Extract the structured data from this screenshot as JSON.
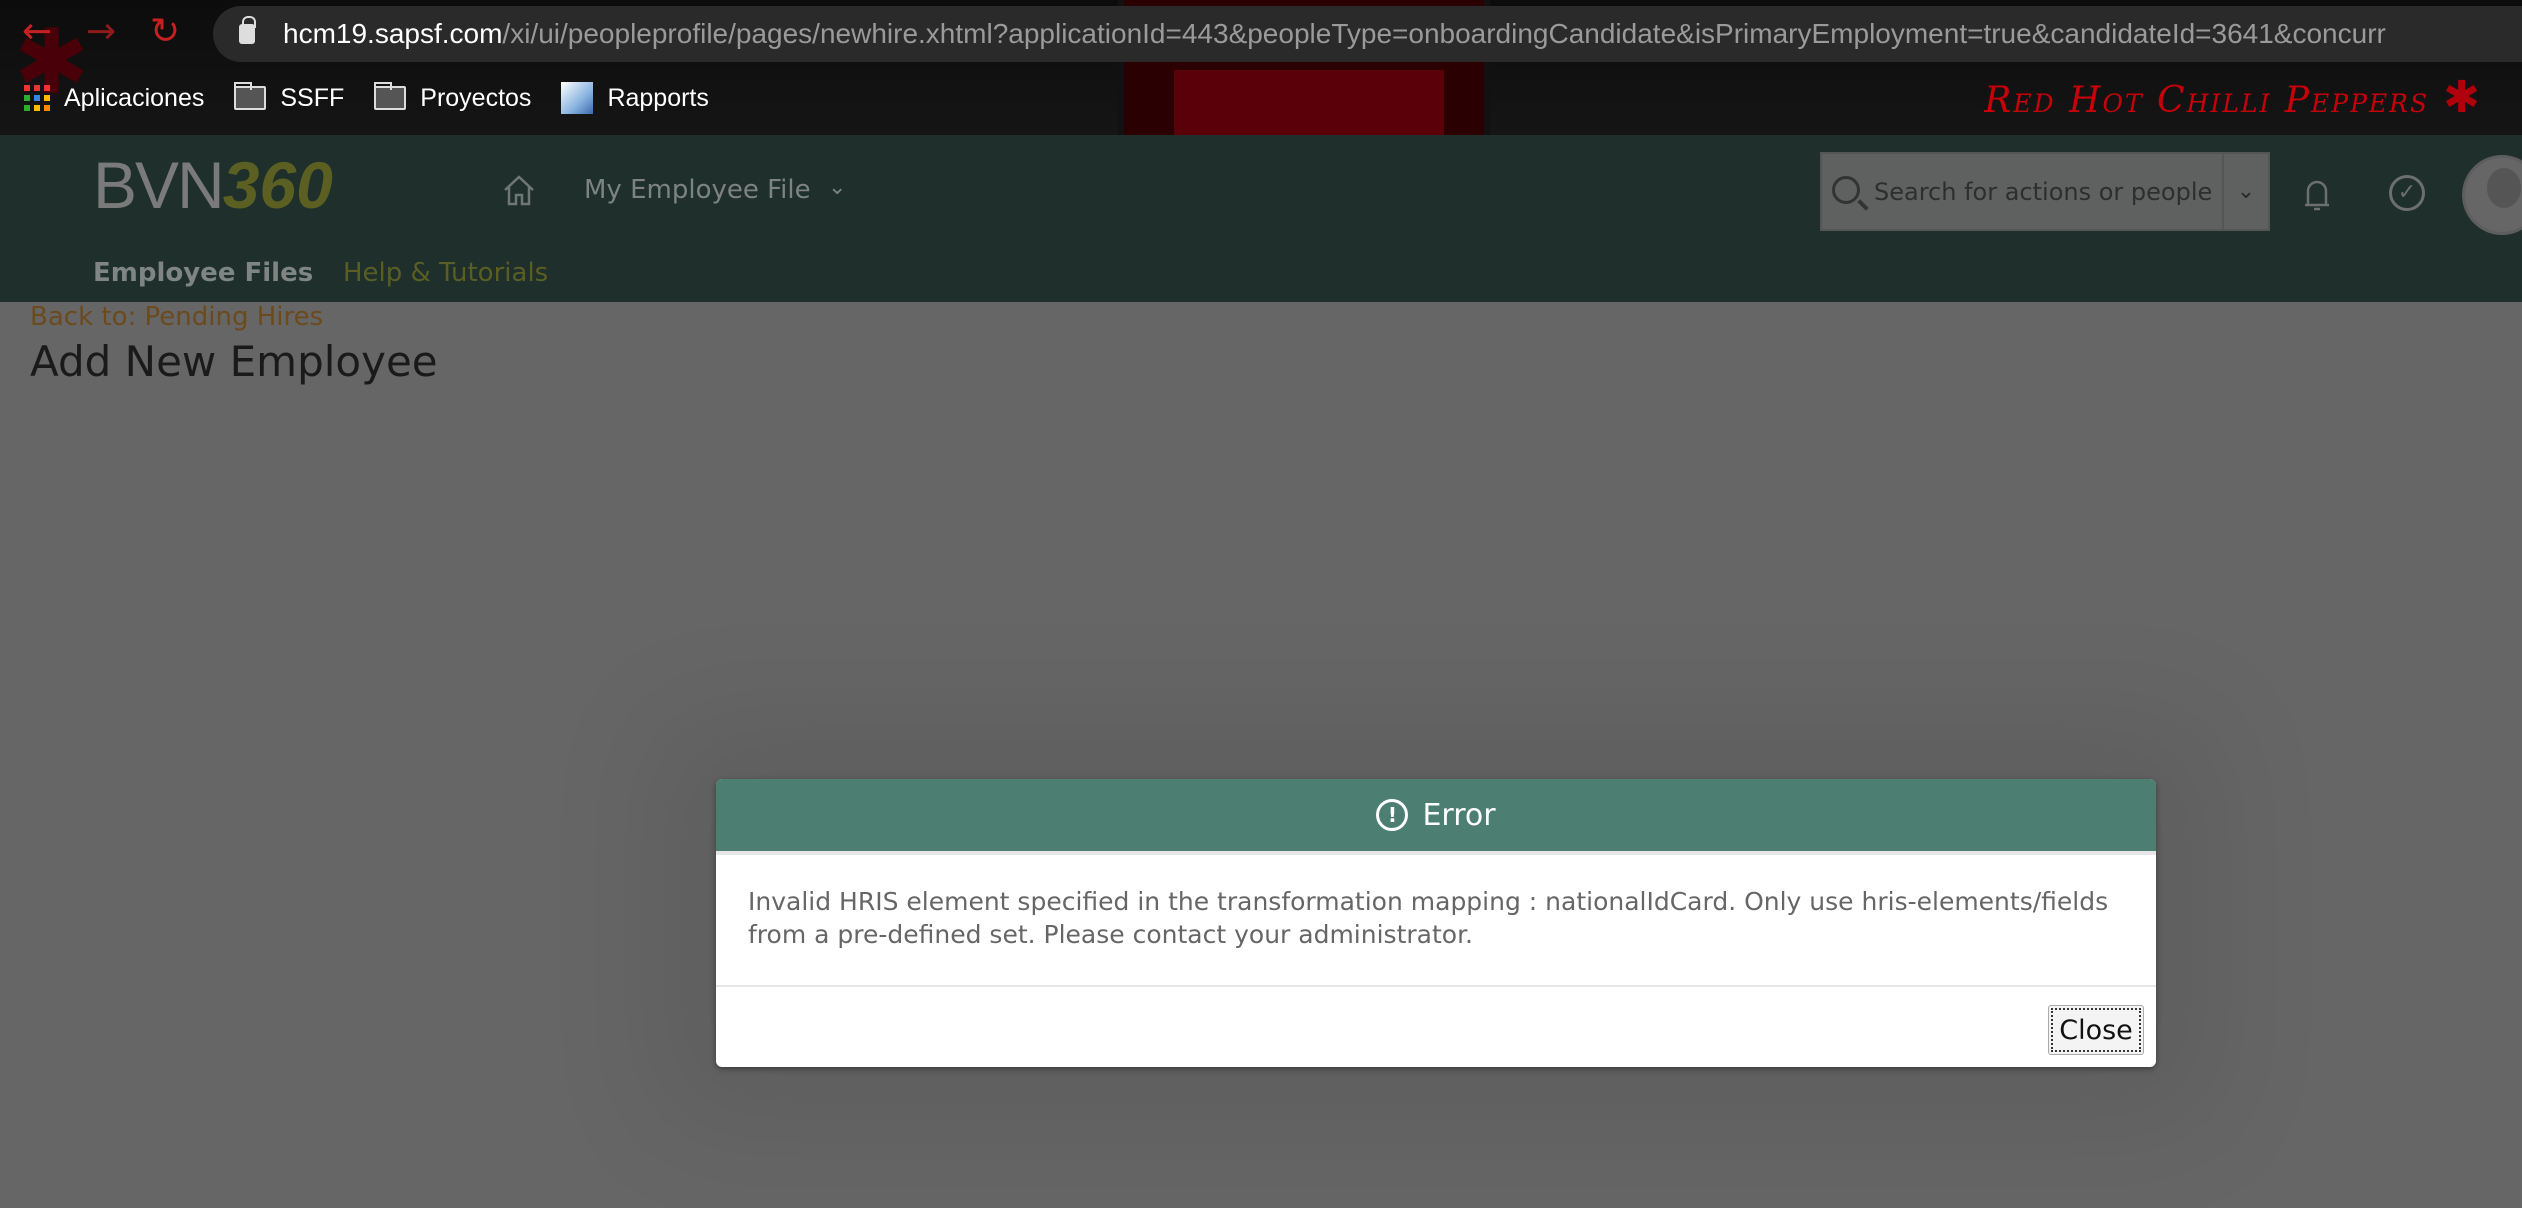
{
  "browser": {
    "url_host": "hcm19.sapsf.com",
    "url_path": "/xi/ui/peopleprofile/pages/newhire.xhtml?applicationId=443&peopleType=onboardingCandidate&isPrimaryEmployment=true&candidateId=3641&concurr",
    "bookmarks": [
      {
        "label": "Aplicaciones",
        "icon": "apps-grid-icon"
      },
      {
        "label": "SSFF",
        "icon": "folder-icon"
      },
      {
        "label": "Proyectos",
        "icon": "folder-icon"
      },
      {
        "label": "Rapports",
        "icon": "rapports-icon"
      }
    ],
    "theme_text": "Red Hot Chilli Peppers"
  },
  "header": {
    "logo": {
      "text": "BVN",
      "number": "360"
    },
    "menu_title": "My Employee File",
    "search_placeholder": "Search for actions or people",
    "tabs": [
      {
        "label": "Employee Files"
      },
      {
        "label": "Help & Tutorials"
      }
    ]
  },
  "page": {
    "back_link": "Back to: Pending Hires",
    "title": "Add New Employee"
  },
  "dialog": {
    "title": "Error",
    "message": "Invalid HRIS element specified in the transformation mapping : nationalIdCard. Only use hris-elements/fields from a pre-defined set. Please contact your administrator.",
    "close_label": "Close",
    "header_color": "#4c7e72"
  }
}
